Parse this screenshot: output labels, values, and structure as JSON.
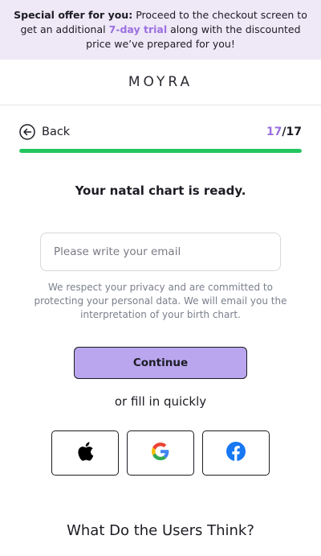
{
  "banner": {
    "lead": "Special offer for you:",
    "text_before": "Proceed to the checkout screen to get an additional",
    "highlight": "7-day trial",
    "text_after": "along with the discounted price we’ve prepared for you!"
  },
  "header": {
    "logo": "MOYRA"
  },
  "nav": {
    "back_label": "Back",
    "step_current": "17",
    "step_total": "/17"
  },
  "progress": {
    "fraction": 1.0,
    "color": "#22c55e"
  },
  "main": {
    "title": "Your natal chart is ready.",
    "email_placeholder": "Please write your email",
    "email_value": "",
    "privacy_note": "We respect your privacy and are committed to protecting your personal data. We will email you the interpretation of your birth chart.",
    "continue_label": "Continue",
    "or_label": "or fill in quickly"
  },
  "social": [
    {
      "name": "apple",
      "icon": "apple-icon"
    },
    {
      "name": "google",
      "icon": "google-icon"
    },
    {
      "name": "facebook",
      "icon": "facebook-icon"
    }
  ],
  "reviews": {
    "heading": "What Do the Users Think?"
  },
  "colors": {
    "accent": "#9b6fe0",
    "banner_bg": "#efe8f7",
    "button_bg": "#b9a6ee",
    "progress": "#22c55e"
  }
}
